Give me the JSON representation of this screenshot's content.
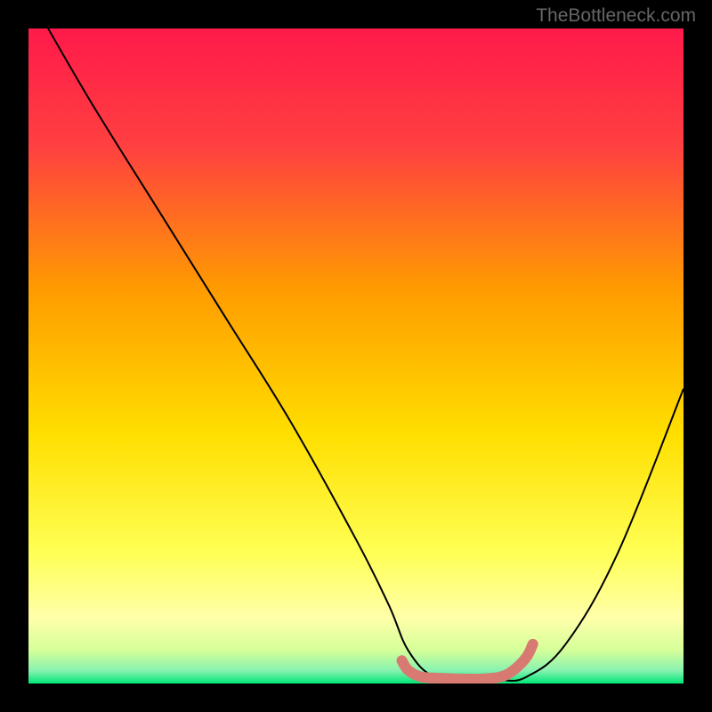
{
  "watermark": "TheBottleneck.com",
  "chart_data": {
    "type": "line",
    "title": "",
    "xlabel": "",
    "ylabel": "",
    "xlim": [
      0,
      100
    ],
    "ylim": [
      0,
      100
    ],
    "background_gradient": {
      "top": "#ff1a4a",
      "mid1": "#ffbb00",
      "mid2": "#ffff66",
      "bottom": "#00e676"
    },
    "series": [
      {
        "name": "bottleneck-curve",
        "color": "#000000",
        "x": [
          3,
          10,
          20,
          30,
          40,
          50,
          55,
          58,
          62,
          68,
          72,
          76,
          82,
          90,
          100
        ],
        "y": [
          100,
          88,
          72,
          56,
          40,
          22,
          12,
          5,
          1,
          0.5,
          0.5,
          1,
          6,
          20,
          45
        ]
      },
      {
        "name": "optimal-zone-marker",
        "color": "#d87a72",
        "x": [
          57,
          58,
          60,
          63,
          66,
          69,
          72,
          74,
          76,
          77
        ],
        "y": [
          3.5,
          2,
          1,
          0.8,
          0.7,
          0.7,
          1,
          2,
          4,
          6
        ]
      }
    ]
  }
}
